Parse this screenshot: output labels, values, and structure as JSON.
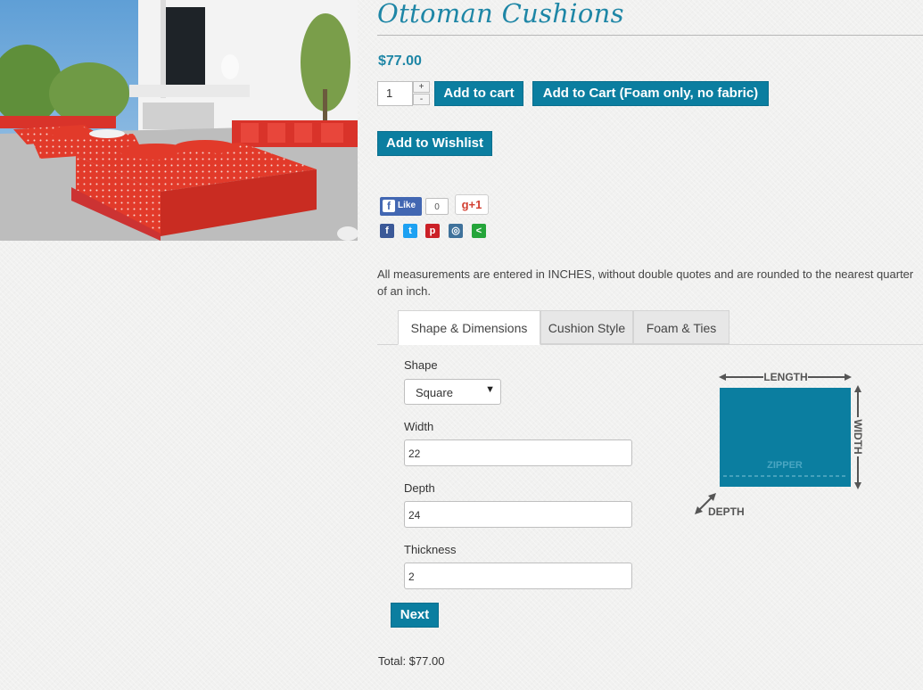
{
  "product": {
    "title": "Ottoman Cushions",
    "price": "$77.00",
    "quantity": "1",
    "qty_up": "+",
    "qty_down": "-",
    "add_to_cart": "Add to cart",
    "add_to_cart_foam": "Add to Cart (Foam only, no fabric)",
    "add_to_wishlist": "Add to Wishlist"
  },
  "social": {
    "like_label": "Like",
    "like_count": "0",
    "gplus_label": "g+1",
    "share_icons": [
      "facebook-icon",
      "twitter-icon",
      "pinterest-icon",
      "instagram-icon",
      "share-icon"
    ],
    "share_colors": [
      "#3b5998",
      "#1da1f2",
      "#cb2027",
      "#3f729b",
      "#25a53a"
    ]
  },
  "note": "All measurements are entered in INCHES, without double quotes and are rounded to the nearest quarter of an inch.",
  "tabs": [
    {
      "label": "Shape & Dimensions",
      "active": true
    },
    {
      "label": "Cushion Style",
      "active": false
    },
    {
      "label": "Foam & Ties",
      "active": false
    }
  ],
  "form": {
    "shape_label": "Shape",
    "shape_value": "Square",
    "width_label": "Width",
    "width_value": "22",
    "depth_label": "Depth",
    "depth_value": "24",
    "thickness_label": "Thickness",
    "thickness_value": "2",
    "next_label": "Next"
  },
  "diagram": {
    "length_label": "LENGTH",
    "width_label": "WIDTH",
    "depth_label": "DEPTH",
    "zipper_label": "ZIPPER",
    "fill_color": "#0b7ea0"
  },
  "total": "Total: $77.00"
}
